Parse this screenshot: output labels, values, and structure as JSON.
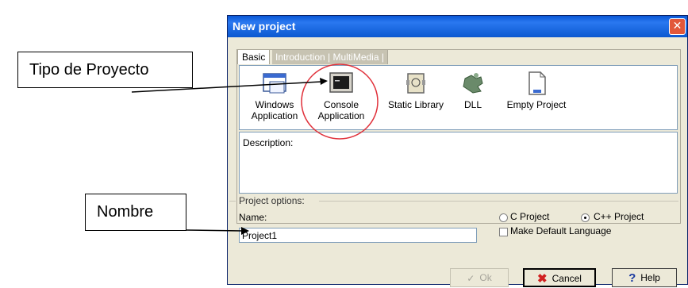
{
  "callouts": {
    "project_type": "Tipo de Proyecto",
    "name": "Nombre"
  },
  "dialog": {
    "title": "New project",
    "tabs": [
      "Basic",
      "Introduction | MultiMedia |"
    ],
    "projects": [
      {
        "line1": "Windows",
        "line2": "Application",
        "icon": "window-icon"
      },
      {
        "line1": "Console",
        "line2": "Application",
        "icon": "console-icon"
      },
      {
        "line1": "Static Library",
        "line2": "",
        "icon": "library-icon"
      },
      {
        "line1": "DLL",
        "line2": "",
        "icon": "dll-puzzle-icon"
      },
      {
        "line1": "Empty Project",
        "line2": "",
        "icon": "empty-doc-icon"
      }
    ],
    "description_label": "Description:",
    "options_title": "Project options:",
    "name_label": "Name:",
    "name_value": "Project1",
    "c_project": "C Project",
    "cpp_project": "C++ Project",
    "make_default": "Make Default Language",
    "ok": "Ok",
    "cancel": "Cancel",
    "help": "Help"
  },
  "colors": {
    "titlebar": "#0a58d6",
    "highlight_circle": "#e0303a"
  }
}
